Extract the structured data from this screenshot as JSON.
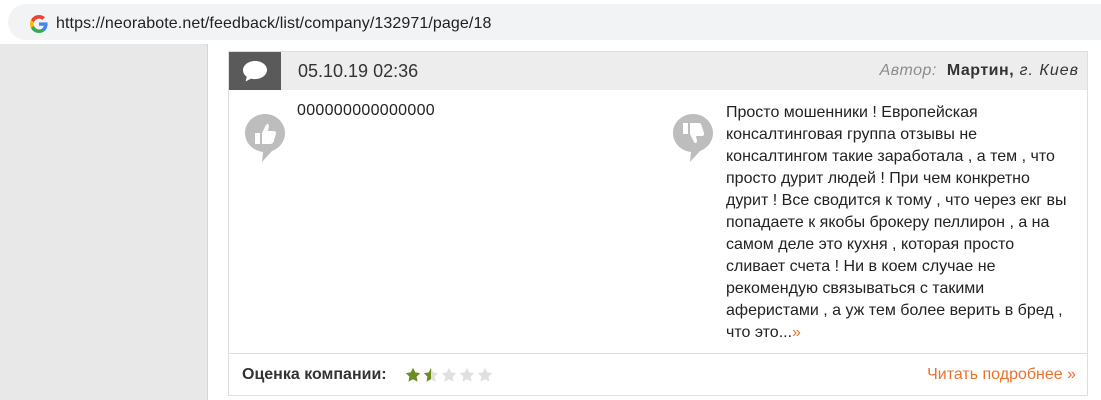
{
  "browser": {
    "url": "https://neorabote.net/feedback/list/company/132971/page/18",
    "site_icon": "google-g-icon"
  },
  "review": {
    "date": "05.10.19 02:36",
    "author_label": "Автор:",
    "author_name": "Мартин",
    "author_separator": ",",
    "author_city": "г. Киев",
    "pros_icon": "thumbs-up-icon",
    "cons_icon": "thumbs-down-icon",
    "pros": "000000000000000",
    "cons": "Просто мошенники ! Европейская консалтинговая группа отзывы не консалтингом такие заработала , а тем , что просто дурит людей ! При чем конкретно дурит ! Все сводится к тому , что через екг вы попадаете к якобы брокеру пеллирон , а на самом деле это кухня , которая просто сливает счета ! Ни в коем случае не рекомендую связываться с такими аферистами , а уж тем более верить в бред , что это...",
    "cons_more": "»",
    "rating_label": "Оценка компании:",
    "rating_value": 1.5,
    "rating_max": 5,
    "read_more": "Читать подробнее »"
  },
  "colors": {
    "accent": "#e8732e",
    "star_filled": "#6b8e23",
    "star_empty": "#e0e0e0",
    "header_bg": "#ededed",
    "icon_bg": "#5a5a5a"
  }
}
